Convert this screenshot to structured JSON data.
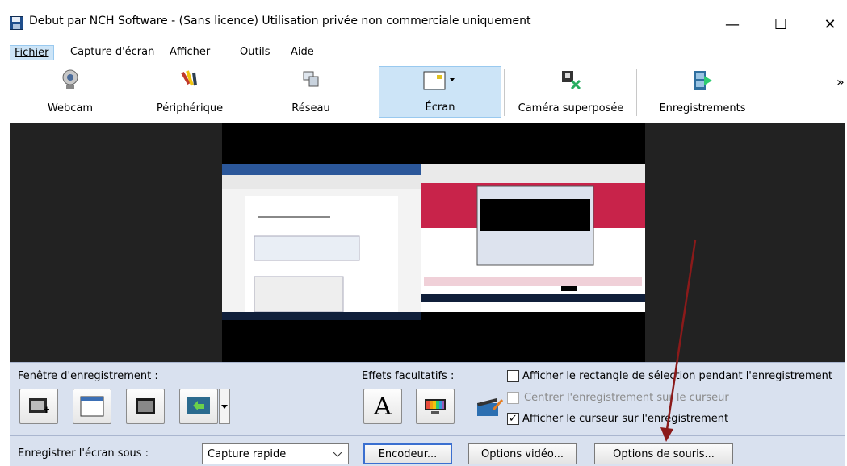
{
  "window": {
    "title": "Debut par NCH Software - (Sans licence) Utilisation privée non commerciale uniquement",
    "minimize": "—",
    "maximize": "☐",
    "close": "✕"
  },
  "menu": [
    "Fichier",
    "Capture d'écran",
    "Afficher",
    "Outils",
    "Aide"
  ],
  "toolbar": {
    "items": [
      "Webcam",
      "Périphérique",
      "Réseau",
      "Écran",
      "Caméra superposée",
      "Enregistrements"
    ],
    "more": "»"
  },
  "panel": {
    "record_window_label": "Fenêtre d'enregistrement :",
    "effects_label": "Effets facultatifs :",
    "text_effect_glyph": "A",
    "options": [
      "Afficher le rectangle de sélection pendant l'enregistrement",
      "Centrer l'enregistrement sur le curseur",
      "Afficher le curseur sur l'enregistrement"
    ],
    "checkmark": "✓",
    "save_as_label": "Enregistrer l'écran sous :",
    "save_as_value": "Capture rapide",
    "encoder_button": "Encodeur...",
    "video_options_button": "Options vidéo...",
    "mouse_options_button": "Options de souris..."
  },
  "colors": {
    "selection": "#cce4f7",
    "panel_bg": "#d9e1ef",
    "annotation_arrow": "#8b1a1a"
  }
}
